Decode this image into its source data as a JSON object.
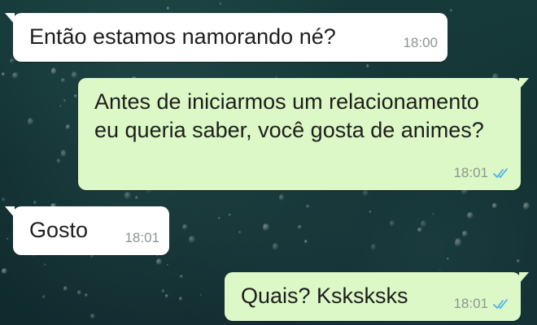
{
  "colors": {
    "incoming_bubble": "#ffffff",
    "outgoing_bubble": "#dcf8c6",
    "read_ticks": "#4fb3e8",
    "timestamp": "#8c9590"
  },
  "messages": [
    {
      "direction": "incoming",
      "text": "Então estamos namorando né?",
      "time": "18:00"
    },
    {
      "direction": "outgoing",
      "text": "Antes de iniciarmos um relacionamento eu queria saber, você gosta de animes?",
      "time": "18:01",
      "status_icon": "double-check-read-icon"
    },
    {
      "direction": "incoming",
      "text": "Gosto",
      "time": "18:01"
    },
    {
      "direction": "outgoing",
      "text": "Quais? Ksksksks",
      "time": "18:01",
      "status_icon": "double-check-read-icon"
    }
  ]
}
